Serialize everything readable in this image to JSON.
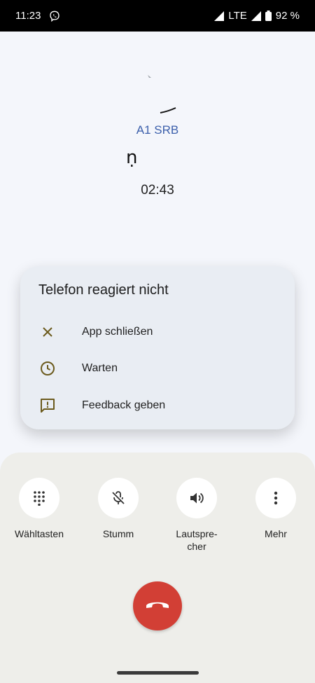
{
  "status_bar": {
    "time": "11:23",
    "network": "LTE",
    "battery": "92 %",
    "icons": [
      "viber-icon",
      "wifi-signal-icon",
      "cell-signal-icon",
      "battery-icon"
    ]
  },
  "call": {
    "carrier": "A1 SRB",
    "glyph": "ṇ",
    "duration": "02:43"
  },
  "dialog": {
    "title": "Telefon reagiert nicht",
    "options": [
      {
        "label": "App schließen",
        "icon": "close-icon"
      },
      {
        "label": "Warten",
        "icon": "clock-icon"
      },
      {
        "label": "Feedback geben",
        "icon": "feedback-icon"
      }
    ],
    "accent_color": "#6b5a1c"
  },
  "controls": [
    {
      "label": "Wähltasten",
      "icon": "dialpad-icon"
    },
    {
      "label": "Stumm",
      "icon": "mic-off-icon"
    },
    {
      "label": "Lautspre-\ncher",
      "icon": "speaker-icon"
    },
    {
      "label": "Mehr",
      "icon": "more-vert-icon"
    }
  ],
  "end_call": {
    "icon": "end-call-icon",
    "color": "#d23f35"
  }
}
